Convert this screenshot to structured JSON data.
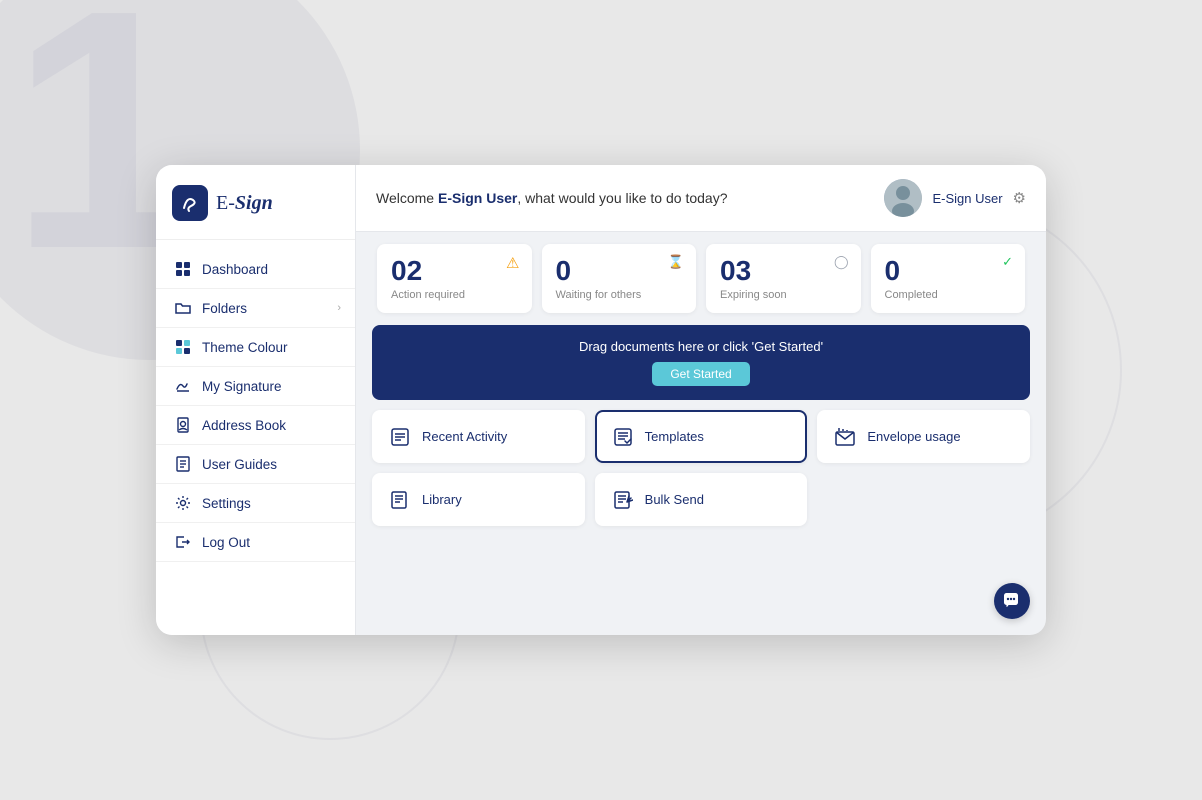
{
  "background": {
    "number": "1"
  },
  "logo": {
    "icon_text": "m",
    "text_part1": "E-",
    "text_part2": "Sign"
  },
  "sidebar": {
    "items": [
      {
        "id": "dashboard",
        "label": "Dashboard",
        "has_arrow": false
      },
      {
        "id": "folders",
        "label": "Folders",
        "has_arrow": true
      },
      {
        "id": "theme-colour",
        "label": "Theme Colour",
        "has_arrow": false
      },
      {
        "id": "my-signature",
        "label": "My Signature",
        "has_arrow": false
      },
      {
        "id": "address-book",
        "label": "Address Book",
        "has_arrow": false
      },
      {
        "id": "user-guides",
        "label": "User Guides",
        "has_arrow": false
      },
      {
        "id": "settings",
        "label": "Settings",
        "has_arrow": false
      },
      {
        "id": "log-out",
        "label": "Log Out",
        "has_arrow": false
      }
    ]
  },
  "header": {
    "welcome_prefix": "Welcome ",
    "username": "E-Sign User",
    "welcome_suffix": ", what would you like to do today?",
    "user_display": "E-Sign User"
  },
  "stats": [
    {
      "id": "action-required",
      "number": "02",
      "label": "Action required",
      "icon": "⚠",
      "icon_class": "orange"
    },
    {
      "id": "waiting",
      "number": "0",
      "label": "Waiting for others",
      "icon": "⏳",
      "icon_class": "gray"
    },
    {
      "id": "expiring",
      "number": "03",
      "label": "Expiring soon",
      "icon": "⊙",
      "icon_class": "gray"
    },
    {
      "id": "completed",
      "number": "0",
      "label": "Completed",
      "icon": "✓",
      "icon_class": "green"
    }
  ],
  "upload_banner": {
    "text": "Drag documents here or click 'Get Started'",
    "button_label": "Get Started"
  },
  "tiles": [
    {
      "id": "recent-activity",
      "label": "Recent Activity",
      "active": false
    },
    {
      "id": "templates",
      "label": "Templates",
      "active": true
    },
    {
      "id": "envelope-usage",
      "label": "Envelope usage",
      "active": false
    },
    {
      "id": "library",
      "label": "Library",
      "active": false
    },
    {
      "id": "bulk-send",
      "label": "Bulk Send",
      "active": false
    }
  ],
  "colors": {
    "primary": "#1a2e6e",
    "accent": "#5bc8d8",
    "warning": "#f59e0b",
    "success": "#22c55e"
  }
}
